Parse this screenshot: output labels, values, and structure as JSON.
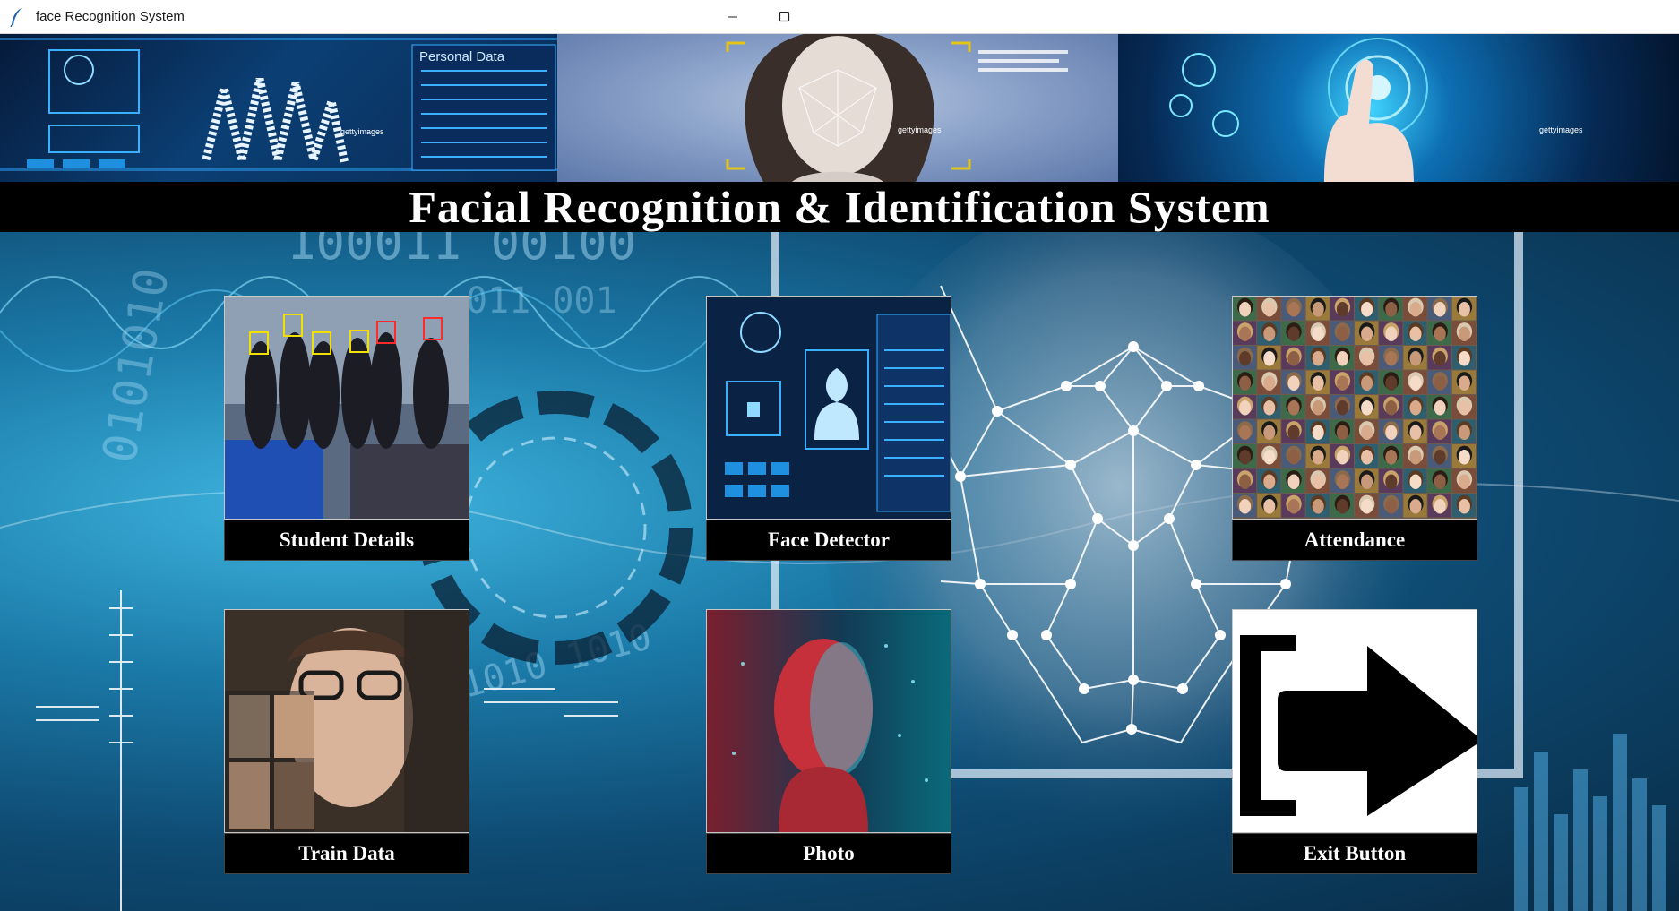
{
  "window": {
    "title": "face Recognition System",
    "controls": {
      "minimize_icon": "minimize-icon",
      "maximize_icon": "maximize-icon"
    }
  },
  "banners": [
    {
      "name": "fingerprint-identify-banner",
      "caption": "Personal Data",
      "watermark": "gettyimages"
    },
    {
      "name": "face-scan-woman-banner",
      "watermark": "gettyimages"
    },
    {
      "name": "touch-interface-banner",
      "watermark": "gettyimages"
    }
  ],
  "header": {
    "title": "Facial Recognition & Identification System"
  },
  "tiles": [
    {
      "id": "student-details",
      "label": "Student Details"
    },
    {
      "id": "face-detector",
      "label": "Face Detector"
    },
    {
      "id": "attendance",
      "label": "Attendance"
    },
    {
      "id": "train-data",
      "label": "Train Data"
    },
    {
      "id": "photo",
      "label": "Photo"
    },
    {
      "id": "exit",
      "label": "Exit Button"
    }
  ],
  "colors": {
    "title_bar": "#ffffff",
    "heading_bg": "#000000",
    "heading_text": "#ffffff",
    "label_bg": "#000000",
    "label_text": "#ffffff",
    "accent_cyan": "#3fd3ff"
  }
}
